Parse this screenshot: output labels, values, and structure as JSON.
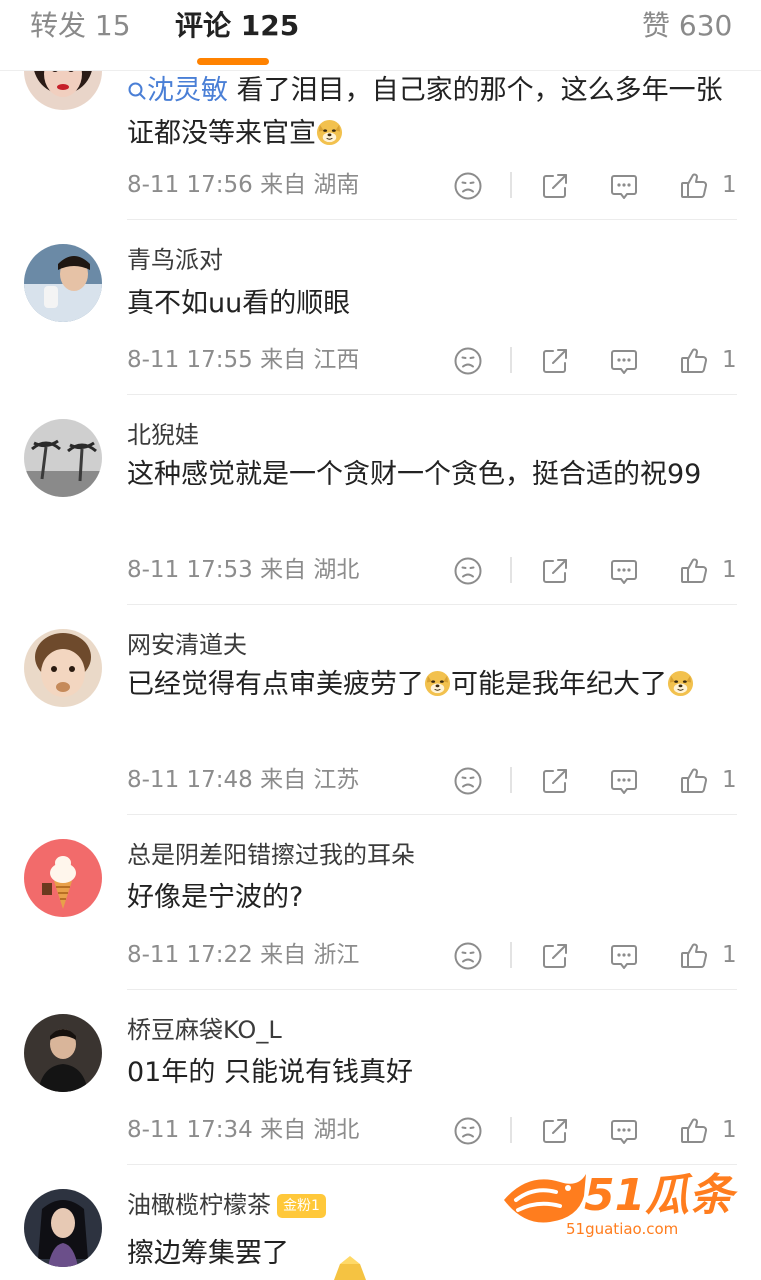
{
  "tabs": {
    "repost_label": "转发",
    "repost_count": "15",
    "comment_label": "评论",
    "comment_count": "125",
    "like_label": "赞",
    "like_count": "630"
  },
  "accent_color": "#ff8200",
  "comments": [
    {
      "username": "沈灵敏",
      "text_parts": [
        "看了泪目，自己家的那个，这么多年一张证都没等来官宣"
      ],
      "time": "8-11 17:56",
      "location": "来自 湖南",
      "likes": "1"
    },
    {
      "username": "青鸟派对",
      "text": "真不如uu看的顺眼",
      "time": "8-11 17:55",
      "location": "来自 江西",
      "likes": "1"
    },
    {
      "username": "北猊娃",
      "text": "这种感觉就是一个贪财一个贪色，挺合适的祝99",
      "time": "8-11 17:53",
      "location": "来自 湖北",
      "likes": "1"
    },
    {
      "username": "网安清道夫",
      "text_parts": [
        "已经觉得有点审美疲劳了",
        "可能是我年纪大了"
      ],
      "time": "8-11 17:48",
      "location": "来自 江苏",
      "likes": "1"
    },
    {
      "username": "总是阴差阳错擦过我的耳朵",
      "text": "好像是宁波的?",
      "time": "8-11 17:22",
      "location": "来自 浙江",
      "likes": "1"
    },
    {
      "username": "桥豆麻袋KO_L",
      "text": "01年的 只能说有钱真好",
      "time": "8-11 17:34",
      "location": "来自 湖北",
      "likes": "1"
    },
    {
      "username": "油橄榄柠檬茶",
      "badge": "金粉1",
      "text": "擦边筹集罢了"
    }
  ],
  "icons": {
    "dislike": "frown-face-icon",
    "repost": "share-arrow-icon",
    "comment": "comment-bubble-icon",
    "like": "thumbs-up-icon",
    "emoji": "doge-emoji-icon"
  },
  "watermark": {
    "title": "51瓜条",
    "url": "51guatiao.com"
  }
}
